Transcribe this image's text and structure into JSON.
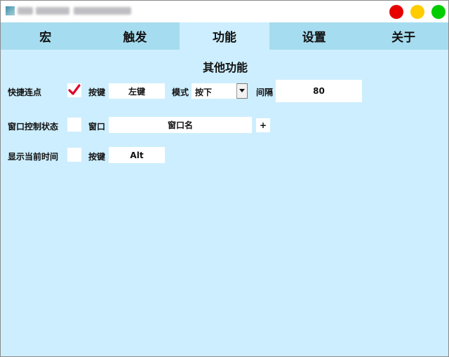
{
  "window": {
    "controls": {
      "close_color": "#e60000",
      "minimize_color": "#ffcc00",
      "maximize_color": "#00cc00"
    }
  },
  "tabs": [
    {
      "label": "宏"
    },
    {
      "label": "触发"
    },
    {
      "label": "功能"
    },
    {
      "label": "设置"
    },
    {
      "label": "关于"
    }
  ],
  "active_tab": "功能",
  "section_title": "其他功能",
  "rows": {
    "quick_click": {
      "label": "快捷连点",
      "checked": true,
      "key_label": "按键",
      "key_value": "左键",
      "mode_label": "模式",
      "mode_value": "按下",
      "interval_label": "间隔",
      "interval_value": "80"
    },
    "window_control": {
      "label": "窗口控制状态",
      "checked": false,
      "window_label": "窗口",
      "window_value": "窗口名",
      "add_label": "+"
    },
    "show_time": {
      "label": "显示当前时间",
      "checked": false,
      "key_label": "按键",
      "key_value": "Alt"
    }
  },
  "colors": {
    "content_bg": "#cdeefe",
    "tabbar_bg": "#a6dcef",
    "check_mark": "#e0002a"
  }
}
